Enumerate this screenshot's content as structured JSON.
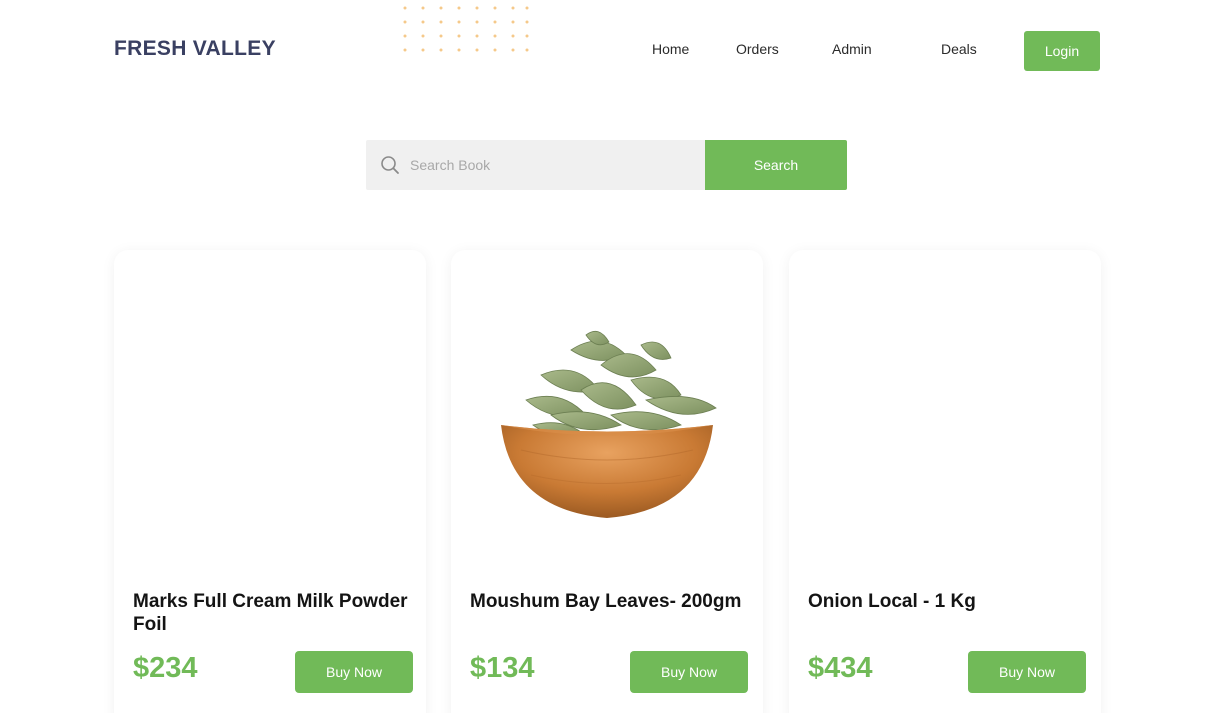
{
  "brand": {
    "name": "FRESH VALLEY"
  },
  "nav": {
    "items": [
      {
        "label": "Home"
      },
      {
        "label": "Orders"
      },
      {
        "label": "Admin"
      },
      {
        "label": "Deals"
      }
    ],
    "login_label": "Login"
  },
  "search": {
    "placeholder": "Search Book",
    "value": "",
    "button_label": "Search",
    "icon": "search-icon"
  },
  "products": [
    {
      "name": "Marks Full Cream Milk Powder Foil",
      "price": "$234",
      "button_label": "Buy Now",
      "image": "none"
    },
    {
      "name": "Moushum Bay Leaves- 200gm",
      "price": "$134",
      "button_label": "Buy Now",
      "image": "bay-leaves-bowl"
    },
    {
      "name": "Onion Local - 1 Kg",
      "price": "$434",
      "button_label": "Buy Now",
      "image": "none"
    }
  ],
  "colors": {
    "accent": "#71ba58",
    "brand_text": "#3a4062",
    "dot_pattern": "#f5c98a"
  }
}
